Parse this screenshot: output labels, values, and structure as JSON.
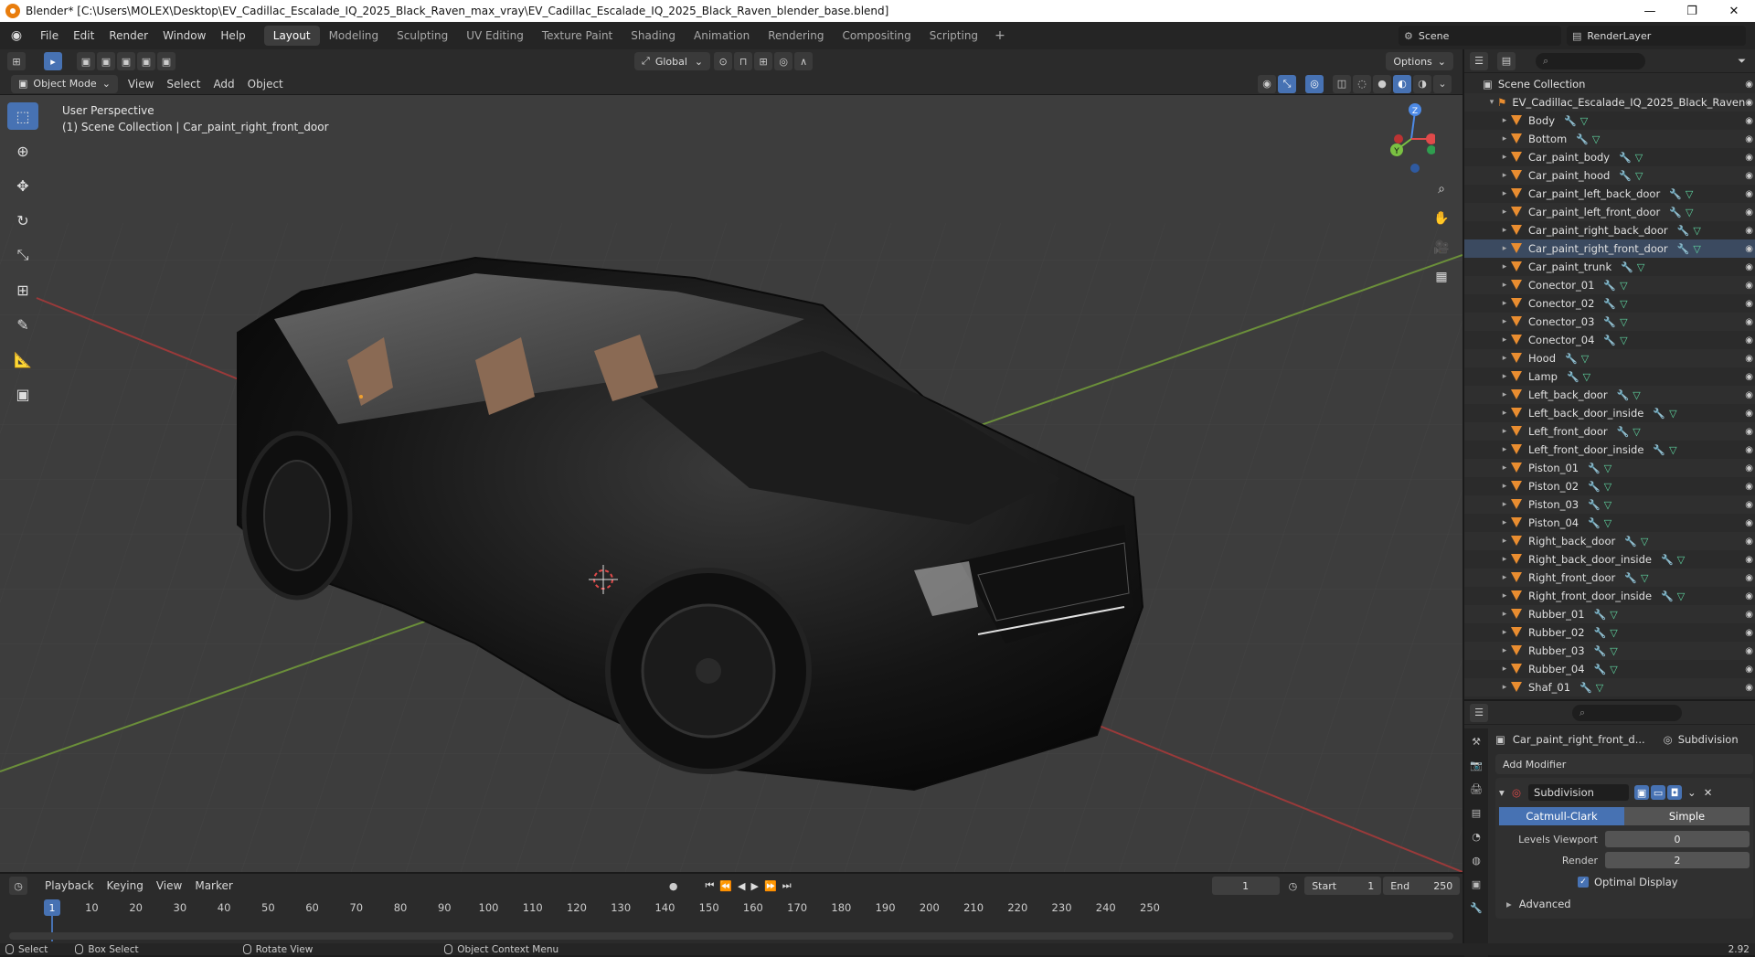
{
  "window": {
    "title": "Blender* [C:\\Users\\MOLEX\\Desktop\\EV_Cadillac_Escalade_IQ_2025_Black_Raven_max_vray\\EV_Cadillac_Escalade_IQ_2025_Black_Raven_blender_base.blend]",
    "min": "—",
    "max": "❐",
    "close": "✕"
  },
  "menu": [
    "File",
    "Edit",
    "Render",
    "Window",
    "Help"
  ],
  "workspaces": [
    "Layout",
    "Modeling",
    "Sculpting",
    "UV Editing",
    "Texture Paint",
    "Shading",
    "Animation",
    "Rendering",
    "Compositing",
    "Scripting"
  ],
  "scene": "Scene",
  "render_layer": "RenderLayer",
  "viewport": {
    "orientation": "Global",
    "options": "Options",
    "mode": "Object Mode",
    "menus": [
      "View",
      "Select",
      "Add",
      "Object"
    ],
    "info_line1": "User Perspective",
    "info_line2": "(1) Scene Collection | Car_paint_right_front_door",
    "gizmo": {
      "z": "Z",
      "y": "Y",
      "x": "X"
    }
  },
  "outliner": {
    "root": "Scene Collection",
    "collection": "EV_Cadillac_Escalade_IQ_2025_Black_Raven",
    "items": [
      "Body",
      "Bottom",
      "Car_paint_body",
      "Car_paint_hood",
      "Car_paint_left_back_door",
      "Car_paint_left_front_door",
      "Car_paint_right_back_door",
      "Car_paint_right_front_door",
      "Car_paint_trunk",
      "Conector_01",
      "Conector_02",
      "Conector_03",
      "Conector_04",
      "Hood",
      "Lamp",
      "Left_back_door",
      "Left_back_door_inside",
      "Left_front_door",
      "Left_front_door_inside",
      "Piston_01",
      "Piston_02",
      "Piston_03",
      "Piston_04",
      "Right_back_door",
      "Right_back_door_inside",
      "Right_front_door",
      "Right_front_door_inside",
      "Rubber_01",
      "Rubber_02",
      "Rubber_03",
      "Rubber_04",
      "Shaf_01"
    ],
    "selected_index": 7
  },
  "properties": {
    "object": "Car_paint_right_front_d...",
    "modifier_context": "Subdivision",
    "add_modifier": "Add Modifier",
    "modifier_name": "Subdivision",
    "mode_a": "Catmull-Clark",
    "mode_b": "Simple",
    "levels_viewport_label": "Levels Viewport",
    "levels_viewport": "0",
    "render_label": "Render",
    "render": "2",
    "optimal_display": "Optimal Display",
    "advanced": "Advanced"
  },
  "timeline": {
    "menus": [
      "Playback",
      "Keying",
      "View",
      "Marker"
    ],
    "current": "1",
    "start_label": "Start",
    "start": "1",
    "end_label": "End",
    "end": "250",
    "ticks": [
      "10",
      "20",
      "30",
      "40",
      "50",
      "60",
      "70",
      "80",
      "90",
      "100",
      "110",
      "120",
      "130",
      "140",
      "150",
      "160",
      "170",
      "180",
      "190",
      "200",
      "210",
      "220",
      "230",
      "240",
      "250"
    ],
    "current_frame_tag": "1"
  },
  "status": {
    "select": "Select",
    "box_select": "Box Select",
    "rotate_view": "Rotate View",
    "context_menu": "Object Context Menu",
    "version": "2.92"
  },
  "colors": {
    "accent": "#4772b3",
    "header": "#2b2b2b",
    "viewport": "#3d3d3d",
    "mesh_orange": "#e98d30"
  }
}
